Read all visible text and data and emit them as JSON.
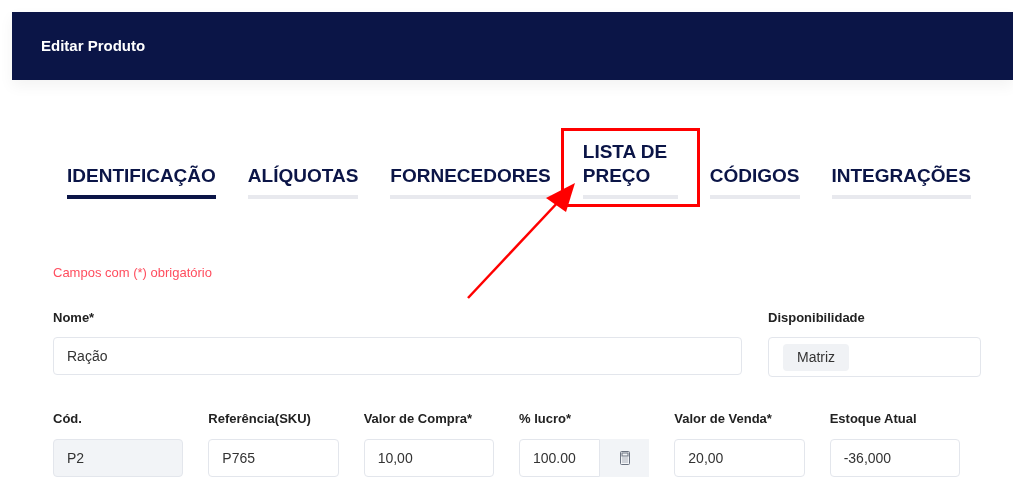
{
  "header": {
    "title": "Editar Produto"
  },
  "tabs": [
    {
      "label": "IDENTIFICAÇÃO",
      "selected": true,
      "highlighted": false
    },
    {
      "label": "ALÍQUOTAS",
      "selected": false,
      "highlighted": false
    },
    {
      "label": "FORNECEDORES",
      "selected": false,
      "highlighted": false
    },
    {
      "label": "LISTA DE PREÇO",
      "selected": false,
      "highlighted": true
    },
    {
      "label": "CÓDIGOS",
      "selected": false,
      "highlighted": false
    },
    {
      "label": "INTEGRAÇÕES",
      "selected": false,
      "highlighted": false
    }
  ],
  "required_note": "Campos com (*) obrigatório",
  "row_1": [
    {
      "label": "Nome*",
      "kind": "text",
      "value": "Ração",
      "disabled": false
    },
    {
      "label": "Disponibilidade",
      "kind": "tags",
      "tags": [
        "Matriz"
      ]
    }
  ],
  "row_2": [
    {
      "label": "Cód.",
      "kind": "text",
      "value": "P2",
      "disabled": true
    },
    {
      "label": "Referência(SKU)",
      "kind": "text",
      "value": "P765",
      "disabled": false
    },
    {
      "label": "Valor de Compra*",
      "kind": "text",
      "value": "10,00",
      "disabled": false
    },
    {
      "label": "% lucro*",
      "kind": "calculator",
      "value": "100.00",
      "disabled": false
    },
    {
      "label": "Valor de Venda*",
      "kind": "text",
      "value": "20,00",
      "disabled": false
    },
    {
      "label": "Estoque Atual",
      "kind": "text",
      "value": "-36,000",
      "disabled": false
    }
  ]
}
